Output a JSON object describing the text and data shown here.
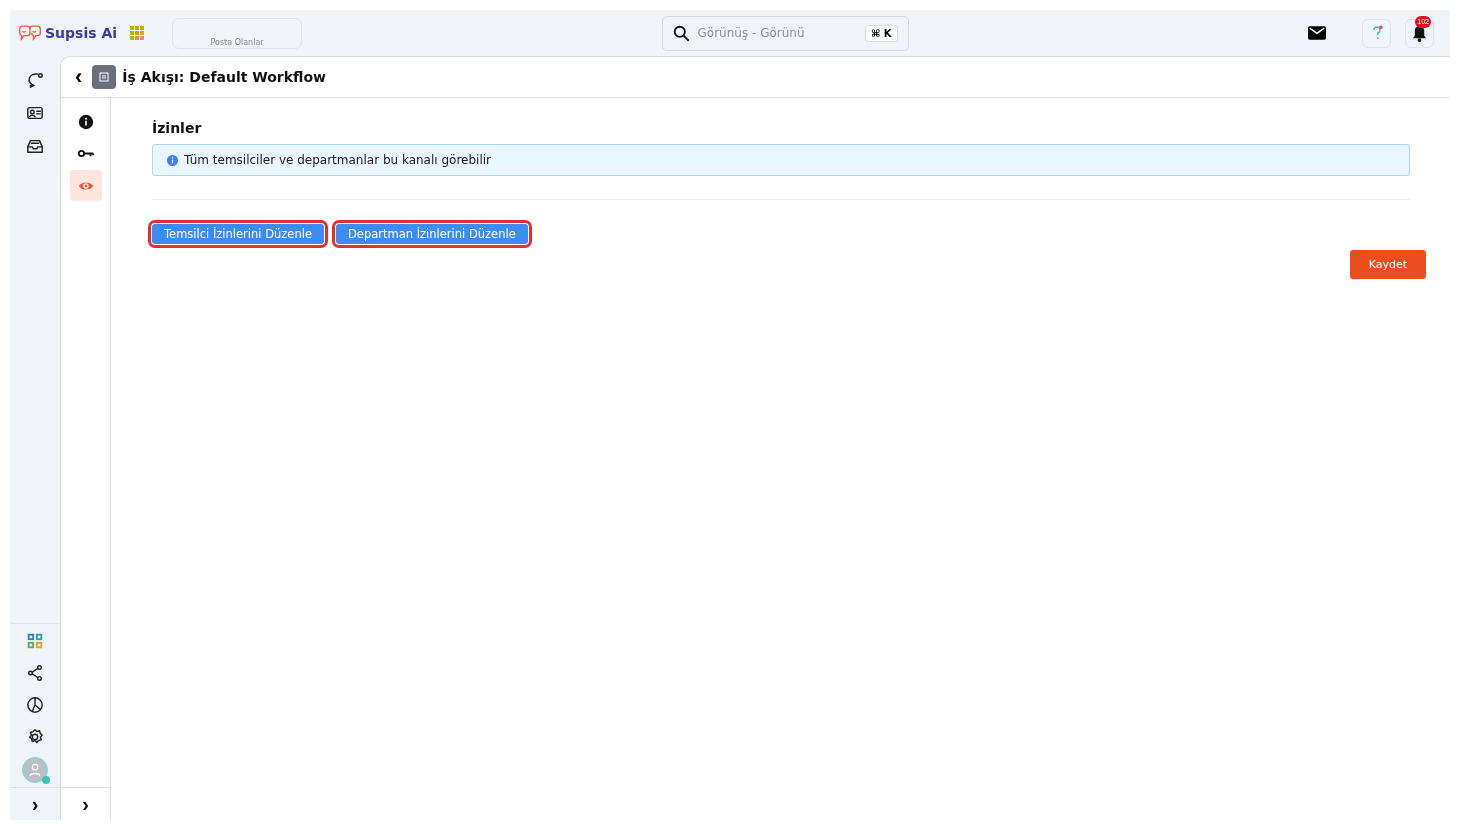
{
  "brand": {
    "name": "Supsis Ai"
  },
  "topbar": {
    "tab_label": "Posta Olanlar",
    "search": {
      "placeholder": "Görünüş - Görünü",
      "shortcut": "⌘ K"
    },
    "notifications": {
      "count": "102"
    }
  },
  "rail": {
    "top": [
      {
        "kind": "chat",
        "selected": false
      },
      {
        "kind": "contact",
        "selected": false
      },
      {
        "kind": "inbox",
        "selected": false
      }
    ],
    "bottom": [
      {
        "kind": "apps",
        "selected": false
      },
      {
        "kind": "share",
        "selected": false
      },
      {
        "kind": "chart",
        "selected": false
      },
      {
        "kind": "settings",
        "selected": false
      }
    ],
    "user": {
      "online": true
    },
    "expand": "›"
  },
  "page": {
    "back": "‹",
    "title": "İş Akışı: Default Workflow"
  },
  "subnav": {
    "items": [
      {
        "kind": "info",
        "selected": false
      },
      {
        "kind": "key",
        "selected": false
      },
      {
        "kind": "eye",
        "selected": true
      }
    ],
    "expand": "›"
  },
  "section": {
    "title": "İzinler",
    "notice": "Tüm temsilciler ve departmanlar bu kanalı görebilir",
    "buttons": [
      {
        "label": "Temsilci İzinlerini Düzenle",
        "highlighted": true
      },
      {
        "label": "Departman İzinlerini Düzenle",
        "highlighted": true
      }
    ],
    "save": "Kaydet"
  }
}
